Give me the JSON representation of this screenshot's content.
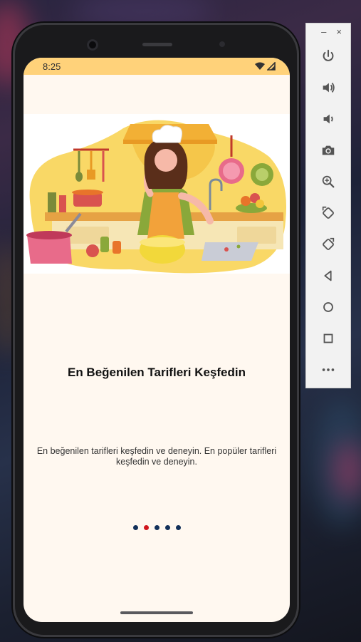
{
  "status_bar": {
    "time": "8:25"
  },
  "onboarding": {
    "title": "En Beğenilen Tarifleri Keşfedin",
    "description": "En beğenilen tarifleri keşfedin ve deneyin. En popüler tarifleri keşfedin ve deneyin.",
    "page_count": 5,
    "active_page": 2
  },
  "emulator_toolbar": {
    "minimize_glyph": "–",
    "close_glyph": "×",
    "buttons": [
      "power-icon",
      "volume-up-icon",
      "volume-down-icon",
      "camera-icon",
      "zoom-icon",
      "rotate-left-icon",
      "rotate-right-icon",
      "back-icon",
      "home-icon",
      "overview-icon",
      "more-icon"
    ]
  },
  "colors": {
    "status_bar": "#ffd27a",
    "screen_bg": "#fff8f0",
    "dot_inactive": "#12305a",
    "dot_active": "#d0161d"
  }
}
